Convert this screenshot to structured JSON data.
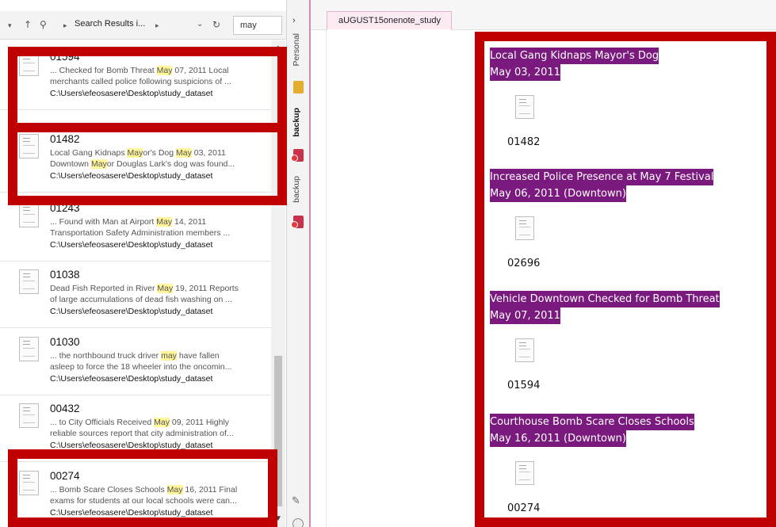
{
  "toolbar": {
    "breadcrumb": "Search Results i...",
    "search_value": "may"
  },
  "results": [
    {
      "id": "01594",
      "snippet": [
        [
          "... Checked for Bomb Threat ",
          false
        ],
        [
          "May",
          true
        ],
        [
          " 07, 2011 Local\nmerchants called police following suspicions of ...",
          false
        ]
      ],
      "path": "C:\\Users\\efeosasere\\Desktop\\study_dataset"
    },
    {
      "id": "01482",
      "snippet": [
        [
          "Local Gang Kidnaps ",
          false
        ],
        [
          "May",
          true
        ],
        [
          "or's Dog ",
          false
        ],
        [
          "May",
          true
        ],
        [
          " 03, 2011\nDowntown ",
          false
        ],
        [
          "May",
          true
        ],
        [
          "or Douglas Lark's dog was found...",
          false
        ]
      ],
      "path": "C:\\Users\\efeosasere\\Desktop\\study_dataset"
    },
    {
      "id": "01243",
      "snippet": [
        [
          "... Found with Man at Airport ",
          false
        ],
        [
          "May",
          true
        ],
        [
          " 14, 2011\nTransportation Safety Administration members ...",
          false
        ]
      ],
      "path": "C:\\Users\\efeosasere\\Desktop\\study_dataset"
    },
    {
      "id": "01038",
      "snippet": [
        [
          "Dead Fish Reported in River ",
          false
        ],
        [
          "May",
          true
        ],
        [
          " 19, 2011 Reports\nof large accumulations of dead fish washing on ...",
          false
        ]
      ],
      "path": "C:\\Users\\efeosasere\\Desktop\\study_dataset"
    },
    {
      "id": "01030",
      "snippet": [
        [
          "... the northbound truck driver ",
          false
        ],
        [
          "may",
          true
        ],
        [
          " have fallen\nasleep to force the 18 wheeler into the oncomin...",
          false
        ]
      ],
      "path": "C:\\Users\\efeosasere\\Desktop\\study_dataset"
    },
    {
      "id": "00432",
      "snippet": [
        [
          "... to City Officials Received ",
          false
        ],
        [
          "May",
          true
        ],
        [
          " 09, 2011 Highly\nreliable sources report that city administration of...",
          false
        ]
      ],
      "path": "C:\\Users\\efeosasere\\Desktop\\study_dataset"
    },
    {
      "id": "00274",
      "snippet": [
        [
          "... Bomb Scare Closes Schools ",
          false
        ],
        [
          "May",
          true
        ],
        [
          " 16, 2011 Final\nexams for students at our local schools were can...",
          false
        ]
      ],
      "path": "C:\\Users\\efeosasere\\Desktop\\study_dataset"
    }
  ],
  "notebooks": {
    "tab1": "Personal",
    "tab2": "backup",
    "tab3": "backup"
  },
  "page": {
    "tab_title": "aUGUST15onenote_study"
  },
  "notes": [
    {
      "title": "Local Gang Kidnaps Mayor's Dog",
      "date": "May 03, 2011",
      "file": "01482"
    },
    {
      "title": "Increased Police Presence at May 7 Festival",
      "date": "May 06, 2011 (Downtown)",
      "file": "02696"
    },
    {
      "title": "Vehicle Downtown Checked for Bomb Threat",
      "date": "May 07, 2011",
      "file": "01594"
    },
    {
      "title": "Courthouse Bomb Scare Closes Schools",
      "date": "May 16, 2011 (Downtown)",
      "file": "00274"
    }
  ],
  "colors": {
    "annotation_red": "#c00000",
    "note_highlight": "#7a1a7e",
    "search_highlight": "#fff59a"
  }
}
